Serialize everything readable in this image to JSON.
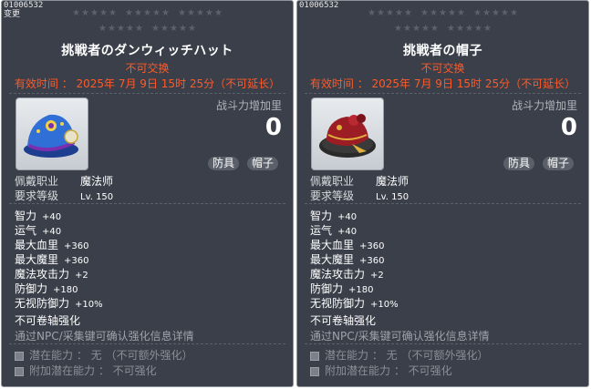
{
  "panels": [
    {
      "item_id": "01006532",
      "changed_label": "变更",
      "title": "挑戦者のダンウィッチハット",
      "tradable": "不可交换",
      "expire": "有效时间 ： 2025年 7月 9日 15时 25分（不可延长）",
      "power_label": "战斗力增加里",
      "power_value": "0",
      "tags": [
        "防具",
        "帽子"
      ],
      "job_label": "佩戴职业",
      "job_value": "魔法师",
      "level_label": "要求等级",
      "level_value": "Lv. 150",
      "stats": [
        {
          "name": "智力",
          "value": "+40"
        },
        {
          "name": "运气",
          "value": "+40"
        },
        {
          "name": "最大血里",
          "value": "+360"
        },
        {
          "name": "最大魔里",
          "value": "+360"
        },
        {
          "name": "魔法攻击力",
          "value": "+2"
        },
        {
          "name": "防御力",
          "value": "+180"
        },
        {
          "name": "无视防御力",
          "value": "+10%"
        }
      ],
      "no_scroll": "不可卷轴强化",
      "npc_info": "通过NPC/采集键可确认强化信息详情",
      "potential": "潜在能力 ： 无 （不可额外强化）",
      "additional_potential": "附加潜在能力 ： 不可强化",
      "hat_colors": {
        "main": "#2f6fd6",
        "band": "#7a2fb0",
        "accent": "#f2d24a"
      }
    },
    {
      "item_id": "01006532",
      "changed_label": "",
      "title": "挑戦者の帽子",
      "tradable": "不可交换",
      "expire": "有效时间 ： 2025年 7月 9日 15时 25分（不可延长）",
      "power_label": "战斗力增加里",
      "power_value": "0",
      "tags": [
        "防具",
        "帽子"
      ],
      "job_label": "佩戴职业",
      "job_value": "魔法师",
      "level_label": "要求等级",
      "level_value": "Lv. 150",
      "stats": [
        {
          "name": "智力",
          "value": "+40"
        },
        {
          "name": "运气",
          "value": "+40"
        },
        {
          "name": "最大血里",
          "value": "+360"
        },
        {
          "name": "最大魔里",
          "value": "+360"
        },
        {
          "name": "魔法攻击力",
          "value": "+2"
        },
        {
          "name": "防御力",
          "value": "+180"
        },
        {
          "name": "无视防御力",
          "value": "+10%"
        }
      ],
      "no_scroll": "不可卷轴强化",
      "npc_info": "通过NPC/采集键可确认强化信息详情",
      "potential": "潜在能力 ： 无 （不可额外强化）",
      "additional_potential": "附加潜在能力 ： 不可强化",
      "hat_colors": {
        "main": "#9c1d24",
        "band": "#2a2a2a",
        "accent": "#e0b23a"
      }
    }
  ]
}
